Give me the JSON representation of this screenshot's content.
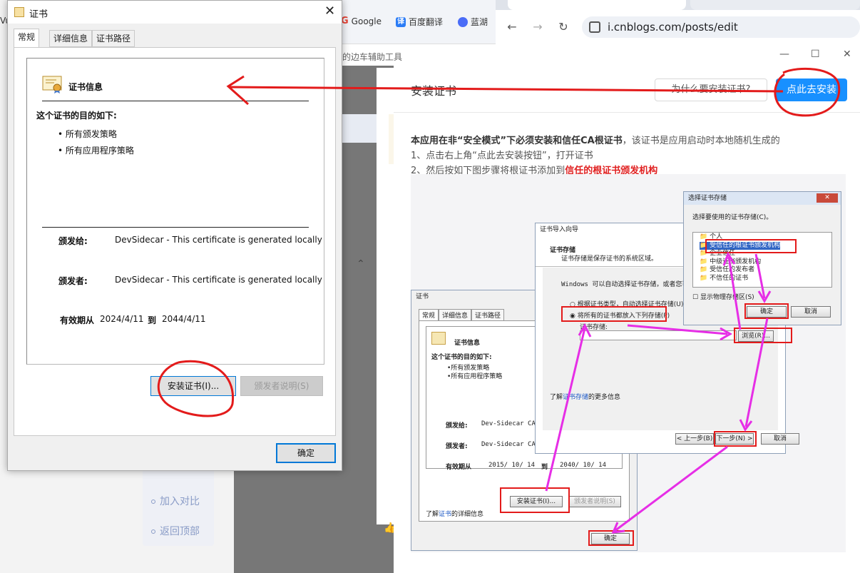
{
  "background": {
    "bookmarks": [
      {
        "label": "Google",
        "icon": "google-icon",
        "color": "#e94235"
      },
      {
        "label": "百度翻译",
        "icon": "translate-icon",
        "icon_char": "译",
        "color": "#2b7cf6"
      },
      {
        "label": "蓝湖",
        "icon": "lanhu-icon",
        "color": "#4a6cf7"
      }
    ],
    "url": "i.cnblogs.com/posts/edit",
    "app_title": "的边车辅助工具",
    "left_edge_text": "Vu",
    "side_links": [
      "加入对比",
      "返回顶部"
    ]
  },
  "install_dialog": {
    "title": "安装证书",
    "why_button": "为什么要安装证书?",
    "install_button": "点此去安装",
    "line1_bold": "本应用在非“安全模式”下必须安装和信任CA根证书",
    "line1_rest": "，该证书是应用启动时本地随机生成的",
    "line2": "1、点击右上角“点此去安装按钮”，打开证书",
    "line3_prefix": "2、然后按如下图步骤将根证书添加到",
    "line3_red": "信任的根证书颁发机构"
  },
  "tutorial": {
    "store_dialog": {
      "title": "选择证书存储",
      "prompt": "选择要使用的证书存储(C)。",
      "items": [
        "个人",
        "受信任的根证书颁发机构",
        "企业信任",
        "中级证书颁发机构",
        "受信任的发布者",
        "不信任的证书"
      ],
      "show_physical": "显示物理存储区(S)",
      "ok": "确定",
      "cancel": "取消"
    },
    "wizard": {
      "title": "证书导入向导",
      "heading": "证书存储",
      "sub": "证书存储是保存证书的系统区域。",
      "desc": "Windows 可以自动选择证书存储，或者您可",
      "opt1": "根据证书类型，自动选择证书存储(U)",
      "opt2": "将所有的证书都放入下列存储(P)",
      "store_label": "证书存储:",
      "browse": "浏览(R)...",
      "more_prefix": "了解",
      "more_link": "证书存储",
      "more_suffix": "的更多信息",
      "back": "< 上一步(B)",
      "next": "下一步(N) >",
      "cancel": "取消"
    },
    "cert": {
      "title": "证书",
      "tabs": [
        "常规",
        "详细信息",
        "证书路径"
      ],
      "info_title": "证书信息",
      "purpose": "这个证书的目的如下:",
      "bullets": [
        "•所有颁发策略",
        "•所有应用程序策略"
      ],
      "issued_to_label": "颁发给:",
      "issued_to": "Dev-Sidecar CA",
      "issued_by_label": "颁发者:",
      "issued_by": "Dev-Sidecar CA",
      "valid_label": "有效期从",
      "valid_from": "2015/ 10/ 14",
      "valid_to_label": "到",
      "valid_to": "2040/ 10/ 14",
      "install_btn": "安装证书(I)...",
      "issuer_btn": "颁发者说明(S)",
      "learn_prefix": "了解",
      "learn_link": "证书",
      "learn_suffix": "的详细信息",
      "ok": "确定"
    }
  },
  "cert_dialog": {
    "title": "证书",
    "tabs": [
      "常规",
      "详细信息",
      "证书路径"
    ],
    "info_title": "证书信息",
    "purpose": "这个证书的目的如下:",
    "bullets": [
      "• 所有颁发策略",
      "• 所有应用程序策略"
    ],
    "issued_to_label": "颁发给:",
    "issued_to": "DevSidecar - This certificate is generated locally",
    "issued_by_label": "颁发者:",
    "issued_by": "DevSidecar - This certificate is generated locally",
    "valid_label": "有效期从",
    "valid_from": "2024/4/11",
    "valid_to_label": "到",
    "valid_to": "2044/4/11",
    "install_button": "安装证书(I)...",
    "issuer_statement_button": "颁发者说明(S)",
    "ok_button": "确定"
  },
  "colors": {
    "annotation_red": "#e31b1b",
    "annotation_magenta": "#e62ee6",
    "primary_blue": "#1890ff"
  }
}
